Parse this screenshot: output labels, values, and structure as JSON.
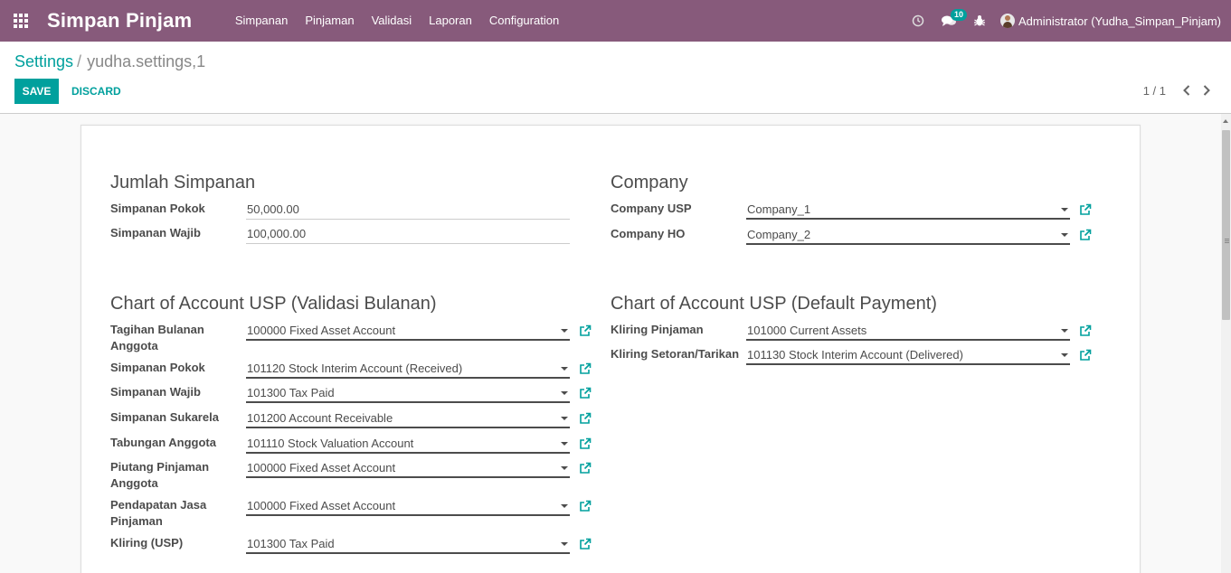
{
  "navbar": {
    "brand": "Simpan Pinjam",
    "menu": [
      "Simpanan",
      "Pinjaman",
      "Validasi",
      "Laporan",
      "Configuration"
    ],
    "chat_badge": "10",
    "user_name": "Administrator (Yudha_Simpan_Pinjam)",
    "bg_color": "#875a7b"
  },
  "control_panel": {
    "breadcrumb_parent": "Settings",
    "breadcrumb_current": "yudha.settings,1",
    "save_label": "SAVE",
    "discard_label": "DISCARD",
    "pager_value": "1 / 1",
    "accent_color": "#00a09d"
  },
  "form": {
    "jumlah_simpanan": {
      "title": "Jumlah Simpanan",
      "simpanan_pokok_label": "Simpanan Pokok",
      "simpanan_pokok_value": "50,000.00",
      "simpanan_wajib_label": "Simpanan Wajib",
      "simpanan_wajib_value": "100,000.00"
    },
    "company": {
      "title": "Company",
      "usp_label": "Company USP",
      "usp_value": "Company_1",
      "ho_label": "Company HO",
      "ho_value": "Company_2"
    },
    "coa_validasi": {
      "title": "Chart of Account USP (Validasi Bulanan)",
      "rows": [
        {
          "label": "Tagihan Bulanan Anggota",
          "value": "100000 Fixed Asset Account"
        },
        {
          "label": "Simpanan Pokok",
          "value": "101120 Stock Interim Account (Received)"
        },
        {
          "label": "Simpanan Wajib",
          "value": "101300 Tax Paid"
        },
        {
          "label": "Simpanan Sukarela",
          "value": "101200 Account Receivable"
        },
        {
          "label": "Tabungan Anggota",
          "value": "101110 Stock Valuation Account"
        },
        {
          "label": "Piutang Pinjaman Anggota",
          "value": "100000 Fixed Asset Account"
        },
        {
          "label": "Pendapatan Jasa Pinjaman",
          "value": "100000 Fixed Asset Account"
        },
        {
          "label": "Kliring (USP)",
          "value": "101300 Tax Paid"
        }
      ]
    },
    "coa_default_payment": {
      "title": "Chart of Account USP (Default Payment)",
      "rows": [
        {
          "label": "Kliring Pinjaman",
          "value": "101000 Current Assets"
        },
        {
          "label": "Kliring Setoran/Tarikan",
          "value": "101130 Stock Interim Account (Delivered)"
        }
      ]
    }
  }
}
